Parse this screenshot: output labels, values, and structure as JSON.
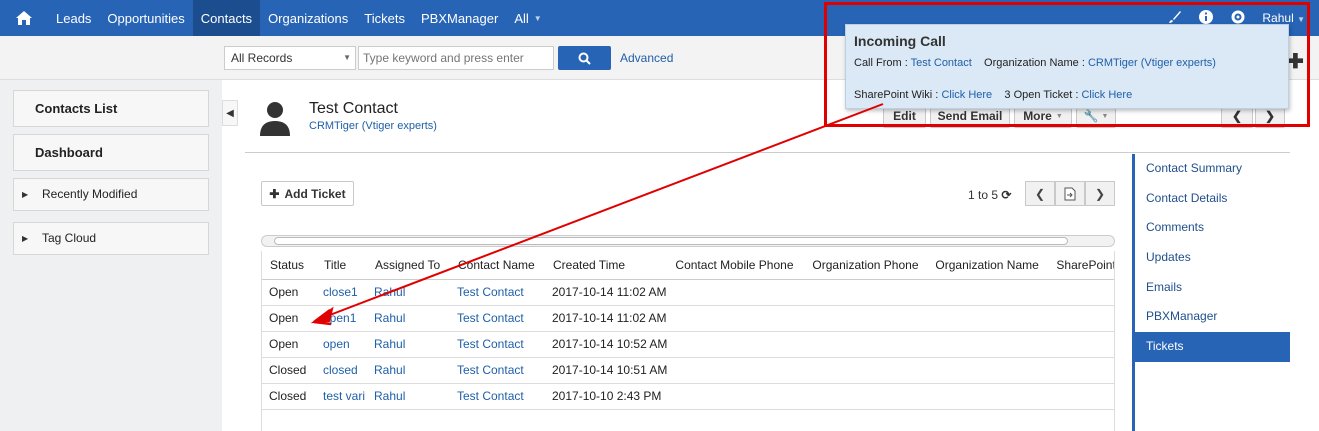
{
  "nav": {
    "items": [
      "Leads",
      "Opportunities",
      "Contacts",
      "Organizations",
      "Tickets",
      "PBXManager",
      "All"
    ],
    "active": "Contacts",
    "user": "Rahul"
  },
  "search": {
    "records_select": "All Records",
    "placeholder": "Type keyword and press enter",
    "advanced": "Advanced"
  },
  "sidebar": {
    "contacts_list": "Contacts List",
    "dashboard": "Dashboard",
    "recently_modified": "Recently Modified",
    "tag_cloud": "Tag Cloud"
  },
  "contact": {
    "name": "Test Contact",
    "organization": "CRMTiger (Vtiger experts)"
  },
  "actions": {
    "edit": "Edit",
    "send_email": "Send Email",
    "more": "More"
  },
  "related": {
    "items": [
      "Contact Summary",
      "Contact Details",
      "Comments",
      "Updates",
      "Emails",
      "PBXManager",
      "Tickets"
    ],
    "active": "Tickets"
  },
  "tickets": {
    "add_label": "Add Ticket",
    "pager": "1 to 5",
    "columns": [
      "Status",
      "Title",
      "Assigned To",
      "Contact Name",
      "Created Time",
      "Contact Mobile Phone",
      "Organization Phone",
      "Organization Name",
      "SharePoint W"
    ],
    "rows": [
      {
        "status": "Open",
        "title": "close1",
        "assigned": "Rahul",
        "contact": "Test Contact",
        "created": "2017-10-14 11:02 AM"
      },
      {
        "status": "Open",
        "title": "open1",
        "assigned": "Rahul",
        "contact": "Test Contact",
        "created": "2017-10-14 11:02 AM"
      },
      {
        "status": "Open",
        "title": "open",
        "assigned": "Rahul",
        "contact": "Test Contact",
        "created": "2017-10-14 10:52 AM"
      },
      {
        "status": "Closed",
        "title": "closed",
        "assigned": "Rahul",
        "contact": "Test Contact",
        "created": "2017-10-14 10:51 AM"
      },
      {
        "status": "Closed",
        "title": "test vari",
        "assigned": "Rahul",
        "contact": "Test Contact",
        "created": "2017-10-10 2:43 PM"
      }
    ]
  },
  "popup": {
    "title": "Incoming Call",
    "call_from_label": "Call From :",
    "call_from_value": "Test Contact",
    "org_label": "Organization Name :",
    "org_value": "CRMTiger (Vtiger experts)",
    "wiki_label": "SharePoint Wiki :",
    "wiki_link": "Click Here",
    "open_ticket_label": "3 Open Ticket :",
    "open_ticket_link": "Click Here"
  },
  "colors": {
    "brand": "#2764b5",
    "annotation": "#e00000",
    "popup_bg": "#dbe9f6"
  }
}
